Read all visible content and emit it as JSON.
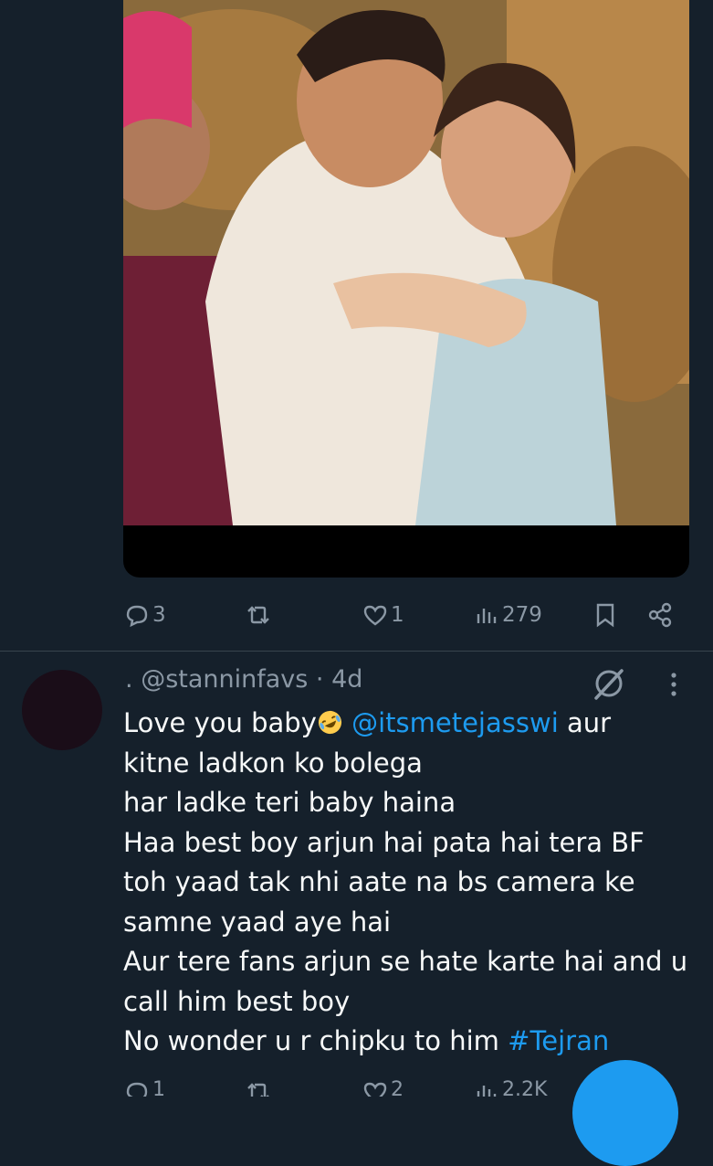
{
  "media": {
    "image_alt": "Photo of people hugging and laughing"
  },
  "post_stats": {
    "replies": "3",
    "reposts": "",
    "likes": "1",
    "views": "279"
  },
  "reply": {
    "display_name": ".",
    "handle": "@stanninfavs",
    "separator": "·",
    "time": "4d",
    "line1_before": "Love you baby",
    "line1_mention": "@itsmetejasswi",
    "line1_after": " aur",
    "line2": "kitne ladkon ko bolega",
    "line3": "har ladke teri baby haina",
    "line4": "Haa best boy arjun hai pata hai tera BF",
    "line5": "toh yaad tak nhi aate na bs camera ke",
    "line6": "samne yaad aye hai",
    "line7": "Aur tere fans arjun se hate karte hai and u",
    "line8": "call him best boy",
    "line9_before": "No wonder u r chipku to him ",
    "line9_hashtag": "#Tejran",
    "emoji": "rolling-on-floor-laughing",
    "stats": {
      "replies": "1",
      "reposts": "",
      "likes": "2",
      "views": "2.2K"
    }
  },
  "colors": {
    "background": "#15202b",
    "text": "#f7f9f9",
    "muted": "#8b98a5",
    "accent": "#1d9bf0",
    "divider": "#38444d"
  }
}
